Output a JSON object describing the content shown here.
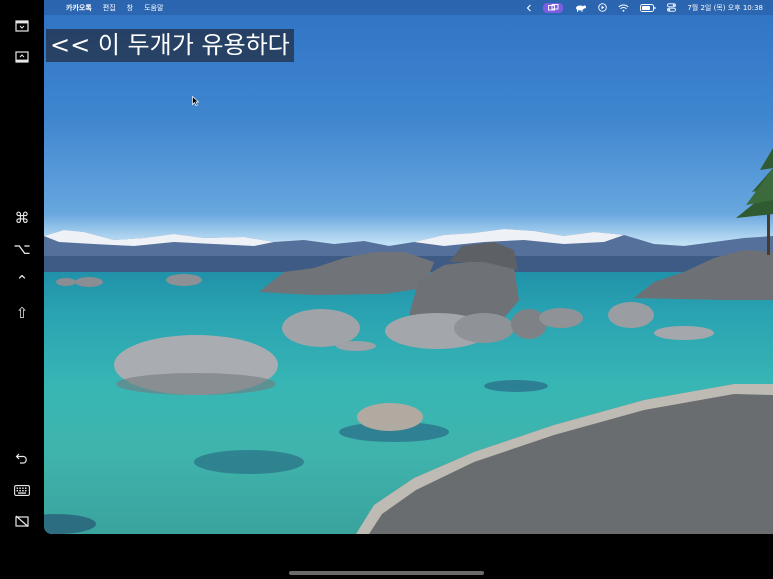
{
  "menubar": {
    "apple": "",
    "app_name": "카카오톡",
    "menus": [
      "편집",
      "창",
      "도움말"
    ],
    "datetime": "7월 2일 (목) 오후 10:38"
  },
  "caption": {
    "text": "<< 이 두개가 유용하다"
  },
  "sidebar": {
    "items": [
      {
        "name": "show-menu-bar",
        "glyph": ""
      },
      {
        "name": "show-dock",
        "glyph": ""
      },
      {
        "name": "command-key",
        "glyph": "⌘"
      },
      {
        "name": "option-key",
        "glyph": "⌥"
      },
      {
        "name": "control-key",
        "glyph": "⌃"
      },
      {
        "name": "shift-key",
        "glyph": "⇧"
      },
      {
        "name": "undo",
        "glyph": ""
      },
      {
        "name": "keyboard",
        "glyph": ""
      },
      {
        "name": "disconnect",
        "glyph": ""
      }
    ]
  },
  "colors": {
    "stage_manager_pill": "#7b5fe0",
    "sky_top": "#2f73c4",
    "water": "#38b6b4"
  }
}
